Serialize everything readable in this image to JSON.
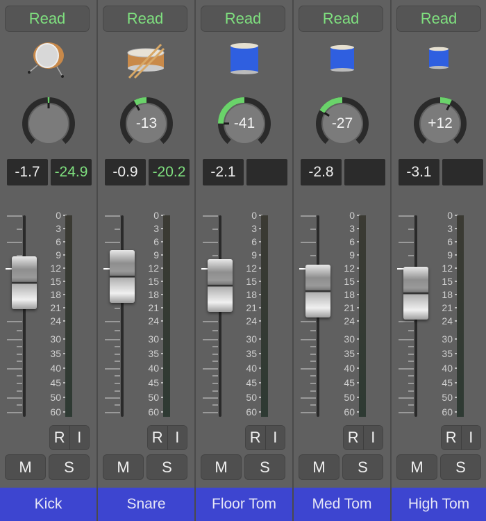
{
  "colors": {
    "accent_green": "#7fe07f",
    "name_bar_blue": "#3d45d0",
    "panel_gray": "#606060"
  },
  "scale_labels": [
    "0",
    "3",
    "6",
    "9",
    "12",
    "15",
    "18",
    "21",
    "24",
    "30",
    "35",
    "40",
    "45",
    "50",
    "60"
  ],
  "channels": [
    {
      "name": "Kick",
      "automation_mode": "Read",
      "instrument_icon": "kick-drum-icon",
      "pan_display": "",
      "pan_value": 0,
      "volume_db": "-1.7",
      "peak_db": "-24.9",
      "fader_level_db": -1.7,
      "record_label": "R",
      "input_label": "I",
      "mute_label": "M",
      "solo_label": "S"
    },
    {
      "name": "Snare",
      "automation_mode": "Read",
      "instrument_icon": "snare-drum-icon",
      "pan_display": "-13",
      "pan_value": -13,
      "volume_db": "-0.9",
      "peak_db": "-20.2",
      "fader_level_db": -0.9,
      "record_label": "R",
      "input_label": "I",
      "mute_label": "M",
      "solo_label": "S"
    },
    {
      "name": "Floor Tom",
      "automation_mode": "Read",
      "instrument_icon": "floor-tom-icon",
      "pan_display": "-41",
      "pan_value": -41,
      "volume_db": "-2.1",
      "peak_db": "",
      "fader_level_db": -2.1,
      "record_label": "R",
      "input_label": "I",
      "mute_label": "M",
      "solo_label": "S"
    },
    {
      "name": "Med Tom",
      "automation_mode": "Read",
      "instrument_icon": "med-tom-icon",
      "pan_display": "-27",
      "pan_value": -27,
      "volume_db": "-2.8",
      "peak_db": "",
      "fader_level_db": -2.8,
      "record_label": "R",
      "input_label": "I",
      "mute_label": "M",
      "solo_label": "S"
    },
    {
      "name": "High Tom",
      "automation_mode": "Read",
      "instrument_icon": "high-tom-icon",
      "pan_display": "+12",
      "pan_value": 12,
      "volume_db": "-3.1",
      "peak_db": "",
      "fader_level_db": -3.1,
      "record_label": "R",
      "input_label": "I",
      "mute_label": "M",
      "solo_label": "S"
    }
  ]
}
